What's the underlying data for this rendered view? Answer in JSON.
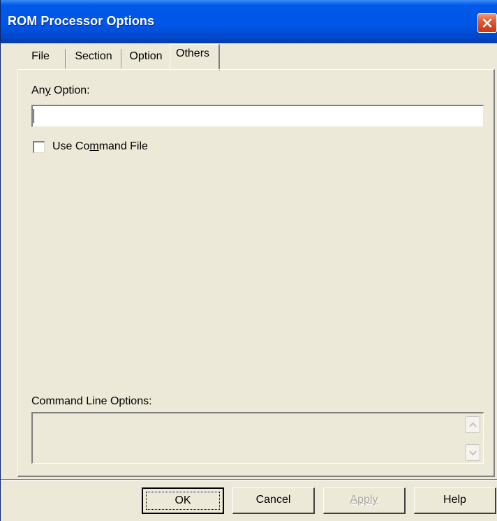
{
  "window": {
    "title": "ROM Processor Options"
  },
  "tabs": [
    {
      "label": "File"
    },
    {
      "label": "Section"
    },
    {
      "label": "Option"
    },
    {
      "label": "Others",
      "selected": true
    }
  ],
  "others_tab": {
    "any_option": {
      "label_pre": "An",
      "label_mnemonic": "y",
      "label_post": " Option:",
      "value": ""
    },
    "use_command_file": {
      "label_pre": "Use Co",
      "label_mnemonic": "m",
      "label_post": "mand File",
      "checked": false
    },
    "command_line_options": {
      "label": "Command Line Options:",
      "value": ""
    }
  },
  "buttons": {
    "ok": "OK",
    "cancel": "Cancel",
    "apply": "Apply",
    "help": "Help"
  },
  "colors": {
    "titlebar": "#0055e5",
    "dialog_bg": "#ece9d8",
    "close_button": "#de5a33"
  }
}
